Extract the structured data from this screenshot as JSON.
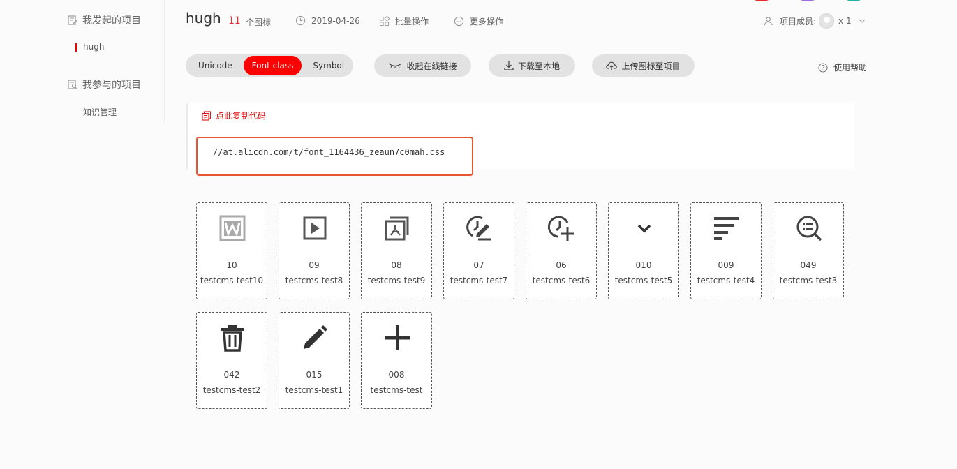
{
  "sidebar": {
    "my_projects_heading": "我发起的项目",
    "my_project_item": "hugh",
    "joined_projects_heading": "我参与的项目",
    "joined_project_item": "知识管理"
  },
  "header": {
    "title": "hugh",
    "icon_count": "11",
    "icon_count_label": "个图标",
    "date": "2019-04-26",
    "batch_ops": "批量操作",
    "more_ops": "更多操作",
    "members_label": "项目成员:",
    "member_count": "x 1"
  },
  "toolbar": {
    "tabs": [
      "Unicode",
      "Font class",
      "Symbol"
    ],
    "active_tab": "Font class",
    "collapse_link": "收起在线链接",
    "download": "下载至本地",
    "upload": "上传图标至项目",
    "help": "使用帮助"
  },
  "code": {
    "copy_label": "点此复制代码",
    "url": "//at.alicdn.com/t/font_1164436_zeaun7c0mah.css"
  },
  "icons": [
    {
      "code": "10",
      "name": "testcms-test10",
      "icon": "word-icon"
    },
    {
      "code": "09",
      "name": "testcms-test8",
      "icon": "play-icon"
    },
    {
      "code": "08",
      "name": "testcms-test9",
      "icon": "pdf-icon"
    },
    {
      "code": "07",
      "name": "testcms-test7",
      "icon": "clock-edit-icon"
    },
    {
      "code": "06",
      "name": "testcms-test6",
      "icon": "clock-add-icon"
    },
    {
      "code": "010",
      "name": "testcms-test5",
      "icon": "chevron-down-icon"
    },
    {
      "code": "009",
      "name": "testcms-test4",
      "icon": "align-left-icon"
    },
    {
      "code": "049",
      "name": "testcms-test3",
      "icon": "search-list-icon"
    },
    {
      "code": "042",
      "name": "testcms-test2",
      "icon": "trash-icon"
    },
    {
      "code": "015",
      "name": "testcms-test1",
      "icon": "pencil-icon"
    },
    {
      "code": "008",
      "name": "testcms-test",
      "icon": "plus-icon"
    }
  ],
  "colors": {
    "accent": "#ff0000",
    "code_border": "#e8542d",
    "dot_red": "#e8262b",
    "dot_purple": "#9b6fe0",
    "dot_teal": "#1fb5a5"
  }
}
